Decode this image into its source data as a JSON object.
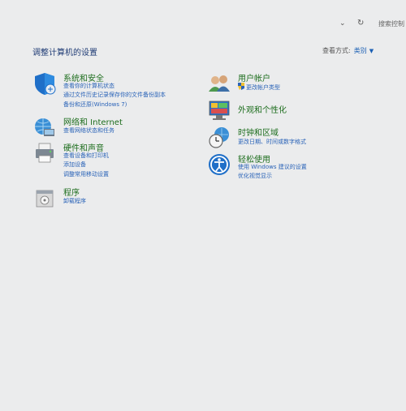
{
  "toolbar": {
    "dropdown_icon": "chevron-down-icon",
    "refresh_icon": "refresh-icon",
    "search_placeholder": "搜索控制"
  },
  "page": {
    "title": "调整计算机的设置",
    "view_by_label": "查看方式:",
    "view_by_value": "类别"
  },
  "categories": {
    "system": {
      "icon": "shield-icon",
      "title": "系统和安全",
      "links": [
        "查看你的计算机状态",
        "通过文件历史记录保存你的文件备份副本",
        "备份和还原(Windows 7)"
      ]
    },
    "network": {
      "icon": "network-globe-icon",
      "title": "网络和 Internet",
      "links": [
        "查看网络状态和任务"
      ]
    },
    "hardware": {
      "icon": "printer-icon",
      "title": "硬件和声音",
      "links": [
        "查看设备和打印机",
        "添加设备",
        "调整常用移动设置"
      ]
    },
    "programs": {
      "icon": "programs-icon",
      "title": "程序",
      "links": [
        "卸载程序"
      ]
    },
    "accounts": {
      "icon": "users-icon",
      "title": "用户帐户",
      "links": [
        "更改帐户类型"
      ]
    },
    "appearance": {
      "icon": "appearance-icon",
      "title": "外观和个性化",
      "links": []
    },
    "clock": {
      "icon": "clock-globe-icon",
      "title": "时钟和区域",
      "links": [
        "更改日期、时间或数字格式"
      ]
    },
    "ease": {
      "icon": "ease-of-access-icon",
      "title": "轻松使用",
      "links": [
        "使用 Windows 建议的设置",
        "优化视觉显示"
      ]
    }
  }
}
